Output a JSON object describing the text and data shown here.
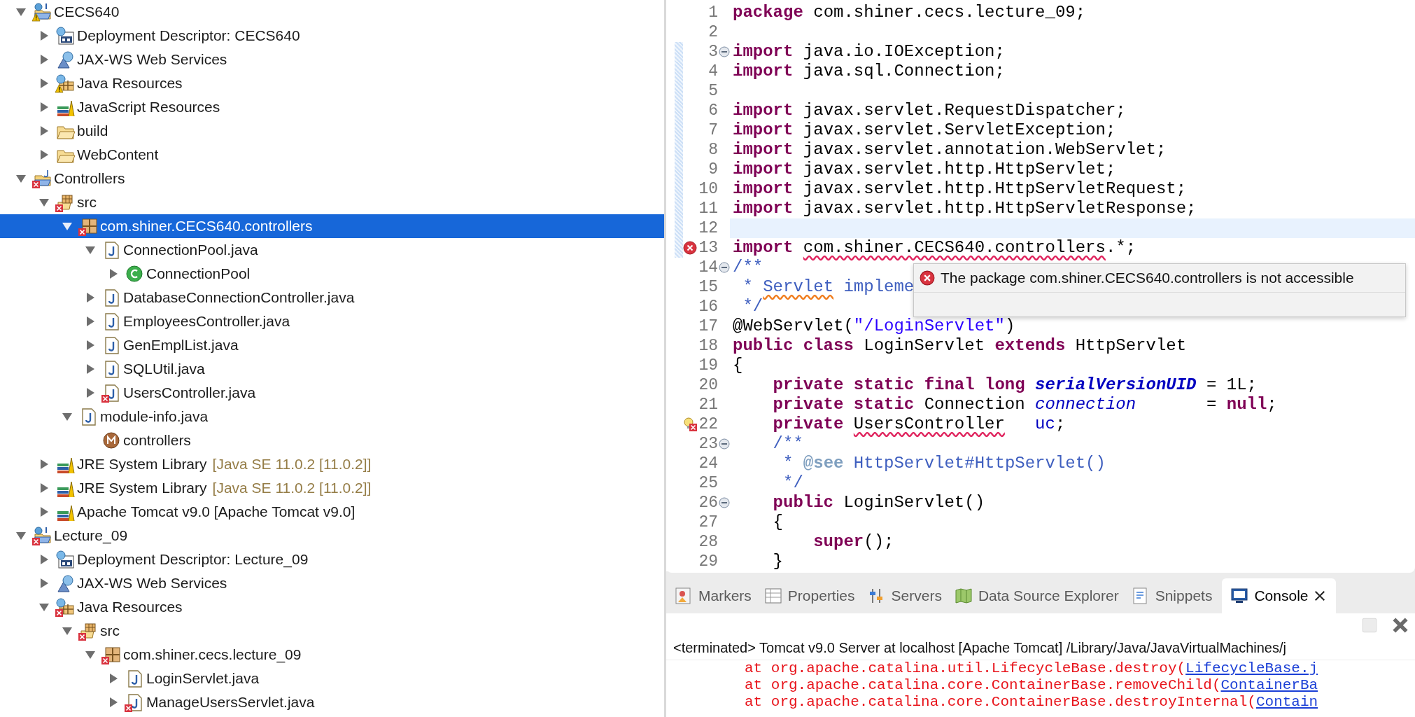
{
  "project_tree": [
    {
      "label": "CECS640",
      "kind": "web-project",
      "error": false,
      "warning": true,
      "expanded": true,
      "selected": false,
      "children": [
        {
          "label": "Deployment Descriptor: CECS640",
          "kind": "deployment",
          "error": false,
          "warning": false,
          "expanded": false,
          "selected": false
        },
        {
          "label": "JAX-WS Web Services",
          "kind": "webservices",
          "error": false,
          "warning": false,
          "expanded": false,
          "selected": false
        },
        {
          "label": "Java Resources",
          "kind": "java-resources",
          "error": false,
          "warning": true,
          "expanded": false,
          "selected": false
        },
        {
          "label": "JavaScript Resources",
          "kind": "library",
          "error": false,
          "warning": false,
          "expanded": false,
          "selected": false
        },
        {
          "label": "build",
          "kind": "folder",
          "error": false,
          "warning": false,
          "expanded": false,
          "selected": false
        },
        {
          "label": "WebContent",
          "kind": "folder",
          "error": false,
          "warning": false,
          "expanded": false,
          "selected": false
        }
      ]
    },
    {
      "label": "Controllers",
      "kind": "java-project",
      "error": true,
      "warning": false,
      "expanded": true,
      "selected": false,
      "children": [
        {
          "label": "src",
          "kind": "source-folder",
          "error": true,
          "warning": false,
          "expanded": true,
          "selected": false,
          "children": [
            {
              "label": "com.shiner.CECS640.controllers",
              "kind": "package",
              "error": true,
              "warning": false,
              "expanded": true,
              "selected": true,
              "children": [
                {
                  "label": "ConnectionPool.java",
                  "kind": "java-file",
                  "error": false,
                  "warning": false,
                  "expanded": true,
                  "selected": false,
                  "children": [
                    {
                      "label": "ConnectionPool",
                      "kind": "class",
                      "error": false,
                      "warning": false,
                      "expanded": false,
                      "selected": false
                    }
                  ]
                },
                {
                  "label": "DatabaseConnectionController.java",
                  "kind": "java-file",
                  "error": false,
                  "warning": false,
                  "expanded": false,
                  "selected": false
                },
                {
                  "label": "EmployeesController.java",
                  "kind": "java-file",
                  "error": false,
                  "warning": false,
                  "expanded": false,
                  "selected": false
                },
                {
                  "label": "GenEmplList.java",
                  "kind": "java-file",
                  "error": false,
                  "warning": false,
                  "expanded": false,
                  "selected": false
                },
                {
                  "label": "SQLUtil.java",
                  "kind": "java-file",
                  "error": false,
                  "warning": false,
                  "expanded": false,
                  "selected": false
                },
                {
                  "label": "UsersController.java",
                  "kind": "java-file",
                  "error": true,
                  "warning": false,
                  "expanded": false,
                  "selected": false
                }
              ]
            },
            {
              "label": "module-info.java",
              "kind": "java-file",
              "error": false,
              "warning": false,
              "expanded": true,
              "selected": false,
              "children": [
                {
                  "label": "controllers",
                  "kind": "module",
                  "error": false,
                  "warning": false,
                  "selected": false
                }
              ]
            }
          ]
        },
        {
          "label": "JRE System Library",
          "suffix": "[Java SE 11.0.2 [11.0.2]]",
          "kind": "library",
          "error": false,
          "warning": false,
          "expanded": false,
          "selected": false
        },
        {
          "label": "JRE System Library",
          "suffix": "[Java SE 11.0.2 [11.0.2]]",
          "kind": "library",
          "error": false,
          "warning": false,
          "expanded": false,
          "selected": false
        },
        {
          "label": "Apache Tomcat v9.0 [Apache Tomcat v9.0]",
          "kind": "library",
          "error": false,
          "warning": false,
          "expanded": false,
          "selected": false
        }
      ]
    },
    {
      "label": "Lecture_09",
      "kind": "web-project",
      "error": true,
      "warning": false,
      "expanded": true,
      "selected": false,
      "children": [
        {
          "label": "Deployment Descriptor: Lecture_09",
          "kind": "deployment",
          "error": false,
          "warning": false,
          "expanded": false,
          "selected": false
        },
        {
          "label": "JAX-WS Web Services",
          "kind": "webservices",
          "error": false,
          "warning": false,
          "expanded": false,
          "selected": false
        },
        {
          "label": "Java Resources",
          "kind": "java-resources",
          "error": true,
          "warning": false,
          "expanded": true,
          "selected": false,
          "children": [
            {
              "label": "src",
              "kind": "source-folder",
              "error": true,
              "warning": false,
              "expanded": true,
              "selected": false,
              "children": [
                {
                  "label": "com.shiner.cecs.lecture_09",
                  "kind": "package",
                  "error": true,
                  "warning": false,
                  "expanded": true,
                  "selected": false,
                  "children": [
                    {
                      "label": "LoginServlet.java",
                      "kind": "java-file",
                      "error": false,
                      "warning": false,
                      "expanded": false,
                      "selected": false
                    },
                    {
                      "label": "ManageUsersServlet.java",
                      "kind": "java-file",
                      "error": true,
                      "warning": false,
                      "expanded": false,
                      "selected": false
                    }
                  ]
                }
              ]
            }
          ]
        }
      ]
    }
  ],
  "editor": {
    "lines": [
      {
        "number": "1",
        "current": false,
        "changed": false,
        "error": false,
        "quickfix": false,
        "fold": false,
        "tokens": [
          {
            "kind": "kw",
            "text": "package"
          },
          {
            "kind": "plain",
            "text": " com.shiner.cecs.lecture_09;"
          }
        ]
      },
      {
        "number": "2",
        "current": false,
        "changed": false,
        "error": false,
        "quickfix": false,
        "fold": false
      },
      {
        "number": "3",
        "current": false,
        "changed": true,
        "error": false,
        "quickfix": false,
        "fold": true,
        "tokens": [
          {
            "kind": "kw",
            "text": "import"
          },
          {
            "kind": "plain",
            "text": " java.io.IOException;"
          }
        ]
      },
      {
        "number": "4",
        "current": false,
        "changed": true,
        "error": false,
        "quickfix": false,
        "fold": false,
        "tokens": [
          {
            "kind": "kw",
            "text": "import"
          },
          {
            "kind": "plain",
            "text": " java.sql.Connection;"
          }
        ]
      },
      {
        "number": "5",
        "current": false,
        "changed": true,
        "error": false,
        "quickfix": false,
        "fold": false
      },
      {
        "number": "6",
        "current": false,
        "changed": true,
        "error": false,
        "quickfix": false,
        "fold": false,
        "tokens": [
          {
            "kind": "kw",
            "text": "import"
          },
          {
            "kind": "plain",
            "text": " javax.servlet.RequestDispatcher;"
          }
        ]
      },
      {
        "number": "7",
        "current": false,
        "changed": true,
        "error": false,
        "quickfix": false,
        "fold": false,
        "tokens": [
          {
            "kind": "kw",
            "text": "import"
          },
          {
            "kind": "plain",
            "text": " javax.servlet.ServletException;"
          }
        ]
      },
      {
        "number": "8",
        "current": false,
        "changed": true,
        "error": false,
        "quickfix": false,
        "fold": false,
        "tokens": [
          {
            "kind": "kw",
            "text": "import"
          },
          {
            "kind": "plain",
            "text": " javax.servlet.annotation.WebServlet;"
          }
        ]
      },
      {
        "number": "9",
        "current": false,
        "changed": true,
        "error": false,
        "quickfix": false,
        "fold": false,
        "tokens": [
          {
            "kind": "kw",
            "text": "import"
          },
          {
            "kind": "plain",
            "text": " javax.servlet.http.HttpServlet;"
          }
        ]
      },
      {
        "number": "10",
        "current": false,
        "changed": true,
        "error": false,
        "quickfix": false,
        "fold": false,
        "tokens": [
          {
            "kind": "kw",
            "text": "import"
          },
          {
            "kind": "plain",
            "text": " javax.servlet.http.HttpServletRequest;"
          }
        ]
      },
      {
        "number": "11",
        "current": false,
        "changed": true,
        "error": false,
        "quickfix": false,
        "fold": false,
        "tokens": [
          {
            "kind": "kw",
            "text": "import"
          },
          {
            "kind": "plain",
            "text": " javax.servlet.http.HttpServletResponse;"
          }
        ]
      },
      {
        "number": "12",
        "current": true,
        "changed": true,
        "error": false,
        "quickfix": false,
        "fold": false
      },
      {
        "number": "13",
        "current": false,
        "changed": true,
        "error": true,
        "quickfix": false,
        "fold": false,
        "tokens": [
          {
            "kind": "kw",
            "text": "import "
          },
          {
            "kind": "err",
            "text": "com.shiner.CECS640.controllers"
          },
          {
            "kind": "plain",
            "text": ".*;"
          }
        ]
      },
      {
        "number": "14",
        "current": false,
        "changed": false,
        "error": false,
        "quickfix": false,
        "fold": true,
        "tokens": [
          {
            "kind": "doc",
            "text": "/**"
          }
        ]
      },
      {
        "number": "15",
        "current": false,
        "changed": false,
        "error": false,
        "quickfix": false,
        "fold": false,
        "tokens": [
          {
            "kind": "doc",
            "text": " * "
          },
          {
            "kind": "spell",
            "text": "Servlet"
          },
          {
            "kind": "doc",
            "text": " impleme"
          }
        ]
      },
      {
        "number": "16",
        "current": false,
        "changed": false,
        "error": false,
        "quickfix": false,
        "fold": false,
        "tokens": [
          {
            "kind": "doc",
            "text": " */"
          }
        ]
      },
      {
        "number": "17",
        "current": false,
        "changed": false,
        "error": false,
        "quickfix": false,
        "fold": false,
        "tokens": [
          {
            "kind": "plain",
            "text": "@WebServlet("
          },
          {
            "kind": "str",
            "text": "\"/LoginServlet\""
          },
          {
            "kind": "plain",
            "text": ")"
          }
        ]
      },
      {
        "number": "18",
        "current": false,
        "changed": false,
        "error": false,
        "quickfix": false,
        "fold": false,
        "tokens": [
          {
            "kind": "kw",
            "text": "public class"
          },
          {
            "kind": "plain",
            "text": " LoginServlet "
          },
          {
            "kind": "kw",
            "text": "extends"
          },
          {
            "kind": "plain",
            "text": " HttpServlet"
          }
        ]
      },
      {
        "number": "19",
        "current": false,
        "changed": false,
        "error": false,
        "quickfix": false,
        "fold": false,
        "tokens": [
          {
            "kind": "plain",
            "text": "{"
          }
        ]
      },
      {
        "number": "20",
        "current": false,
        "changed": false,
        "error": false,
        "quickfix": false,
        "fold": false,
        "tokens": [
          {
            "kind": "kw",
            "text": "    private static final long "
          },
          {
            "kind": "sfield",
            "text": "serialVersionUID"
          },
          {
            "kind": "plain",
            "text": " = 1L;"
          }
        ]
      },
      {
        "number": "21",
        "current": false,
        "changed": false,
        "error": false,
        "quickfix": false,
        "fold": false,
        "tokens": [
          {
            "kind": "kw",
            "text": "    private static"
          },
          {
            "kind": "plain",
            "text": " Connection "
          },
          {
            "kind": "field",
            "text": "connection"
          },
          {
            "kind": "plain",
            "text": "       = "
          },
          {
            "kind": "kw",
            "text": "null"
          },
          {
            "kind": "plain",
            "text": ";"
          }
        ]
      },
      {
        "number": "22",
        "current": false,
        "changed": false,
        "error": false,
        "quickfix": true,
        "fold": false,
        "tokens": [
          {
            "kind": "kw",
            "text": "    private "
          },
          {
            "kind": "err",
            "text": "UsersController"
          },
          {
            "kind": "ref",
            "text": "   uc"
          },
          {
            "kind": "plain",
            "text": ";"
          }
        ]
      },
      {
        "number": "23",
        "current": false,
        "changed": false,
        "error": false,
        "quickfix": false,
        "fold": true,
        "tokens": [
          {
            "kind": "doc",
            "text": "    /**"
          }
        ]
      },
      {
        "number": "24",
        "current": false,
        "changed": false,
        "error": false,
        "quickfix": false,
        "fold": false,
        "tokens": [
          {
            "kind": "doc",
            "text": "     * "
          },
          {
            "kind": "doctag",
            "text": "@see"
          },
          {
            "kind": "doc",
            "text": " HttpServlet#HttpServlet()"
          }
        ]
      },
      {
        "number": "25",
        "current": false,
        "changed": false,
        "error": false,
        "quickfix": false,
        "fold": false,
        "tokens": [
          {
            "kind": "doc",
            "text": "     */"
          }
        ]
      },
      {
        "number": "26",
        "current": false,
        "changed": false,
        "error": false,
        "quickfix": false,
        "fold": true,
        "tokens": [
          {
            "kind": "kw",
            "text": "    public"
          },
          {
            "kind": "plain",
            "text": " LoginServlet()"
          }
        ]
      },
      {
        "number": "27",
        "current": false,
        "changed": false,
        "error": false,
        "quickfix": false,
        "fold": false,
        "tokens": [
          {
            "kind": "plain",
            "text": "    {"
          }
        ]
      },
      {
        "number": "28",
        "current": false,
        "changed": false,
        "error": false,
        "quickfix": false,
        "fold": false,
        "tokens": [
          {
            "kind": "kw",
            "text": "        super"
          },
          {
            "kind": "plain",
            "text": "();"
          }
        ]
      },
      {
        "number": "29",
        "current": false,
        "changed": false,
        "error": false,
        "quickfix": false,
        "fold": false,
        "tokens": [
          {
            "kind": "plain",
            "text": "    }"
          }
        ]
      }
    ],
    "tooltip": {
      "text": "The package com.shiner.CECS640.controllers is not accessible"
    }
  },
  "bottom_panel": {
    "tabs": [
      {
        "label": "Markers",
        "kind": "markers",
        "selected": false,
        "closable": false
      },
      {
        "label": "Properties",
        "kind": "properties",
        "selected": false,
        "closable": false
      },
      {
        "label": "Servers",
        "kind": "servers",
        "selected": false,
        "closable": false
      },
      {
        "label": "Data Source Explorer",
        "kind": "datasource",
        "selected": false,
        "closable": false
      },
      {
        "label": "Snippets",
        "kind": "snippets",
        "selected": false,
        "closable": false
      },
      {
        "label": "Console",
        "kind": "console",
        "selected": true,
        "closable": true
      }
    ],
    "toolbar": [
      {
        "kind": "stop",
        "disabled": true
      },
      {
        "kind": "remove-all",
        "disabled": false
      }
    ],
    "console": {
      "status": "<terminated> Tomcat v9.0 Server at localhost [Apache Tomcat] /Library/Java/JavaVirtualMachines/j",
      "lines": [
        {
          "text": "at org.apache.catalina.util.LifecycleBase.destroy(",
          "link": "LifecycleBase.j"
        },
        {
          "text": "at org.apache.catalina.core.ContainerBase.removeChild(",
          "link": "ContainerBa"
        },
        {
          "text": "at org.apache.catalina.core.ContainerBase.destroyInternal(",
          "link": "Contain"
        }
      ]
    }
  }
}
